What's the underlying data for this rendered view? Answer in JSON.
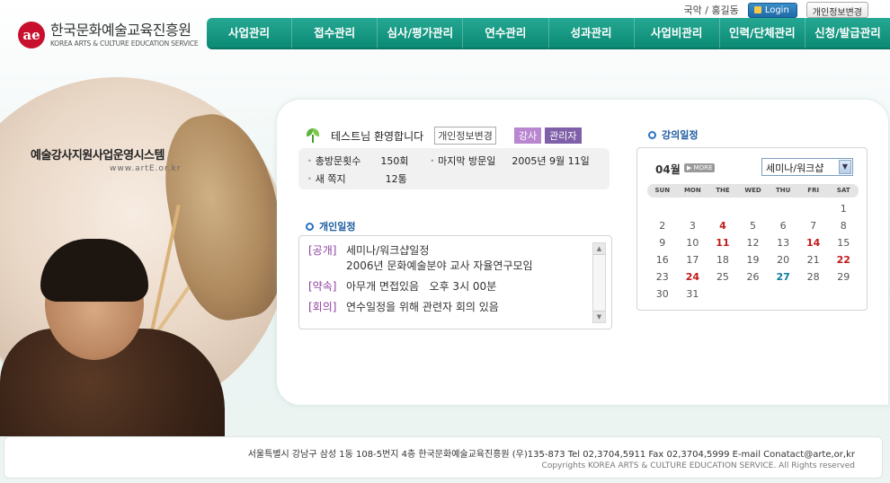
{
  "header": {
    "logo_mark": "ae",
    "logo_korean": "한국문화예술교육진흥원",
    "logo_english": "KOREA ARTS & CULTURE EDUCATION SERVICE",
    "user_text": "국악 / 홍길동",
    "login_label": "Login",
    "profile_label": "개인정보변경"
  },
  "nav": {
    "items": [
      "사업관리",
      "접수관리",
      "심사/평가관리",
      "연수관리",
      "성과관리",
      "사업비관리",
      "인력/단체관리",
      "신청/발급관리"
    ]
  },
  "hero": {
    "system_title": "예술강사지원사업운영시스템",
    "url": "www.artE.or.kr"
  },
  "welcome": {
    "greeting": "테스트님 환영합니다",
    "edit_button": "개인정보변경",
    "role_instructor": "강사",
    "role_admin": "관리자"
  },
  "visits": {
    "total_label": "총방문횟수",
    "total_value": "150회",
    "last_label": "마지막 방문일",
    "last_value": "2005년 9월 11일",
    "new_note_label": "새 쪽지",
    "new_note_value": "12통"
  },
  "personal_schedule": {
    "title": "개인일정",
    "items": [
      {
        "tag": "[공개]",
        "line1": "세미나/워크샵일정",
        "line2": "2006년 문화예술분야 교사 자율연구모임"
      },
      {
        "tag": "[약속]",
        "line1": "아무개 면접있음   오후 3시 00분",
        "line2": ""
      },
      {
        "tag": "[회의]",
        "line1": "연수일정을 위해 관련자 회의 있음",
        "line2": ""
      }
    ]
  },
  "lecture_schedule": {
    "title": "강의일정",
    "month": "04월",
    "more_label": "MORE",
    "select_value": "세미나/워크샵",
    "weekdays": [
      "SUN",
      "MON",
      "THE",
      "WED",
      "THU",
      "FRI",
      "SAT"
    ],
    "weeks": [
      [
        "",
        "",
        "",
        "",
        "",
        "",
        "1"
      ],
      [
        "2",
        "3",
        "4",
        "5",
        "6",
        "7",
        "8"
      ],
      [
        "9",
        "10",
        "11",
        "12",
        "13",
        "14",
        "15"
      ],
      [
        "16",
        "17",
        "18",
        "19",
        "20",
        "21",
        "22"
      ],
      [
        "23",
        "24",
        "25",
        "26",
        "27",
        "28",
        "29"
      ],
      [
        "30",
        "31",
        "",
        "",
        "",
        "",
        ""
      ]
    ],
    "highlight_red": [
      "4",
      "11",
      "14",
      "22",
      "24"
    ],
    "highlight_today": [
      "27"
    ]
  },
  "footer": {
    "address": "서울특별시 강남구 삼성 1동 108-5번지 4층 한국문화예술교육진흥원 (우)135-873    Tel 02,3704,5911 Fax 02,3704,5999 E-mail Conatact@arte,or,kr",
    "copyright": "Copyrights KOREA ARTS & CULTURE EDUCATION SERVICE. All Rights reserved"
  },
  "colors": {
    "nav_green": "#0b8a74",
    "accent_blue": "#1c5aa0",
    "tag_purple": "#8f3fa0",
    "highlight_red": "#c21a1a"
  }
}
